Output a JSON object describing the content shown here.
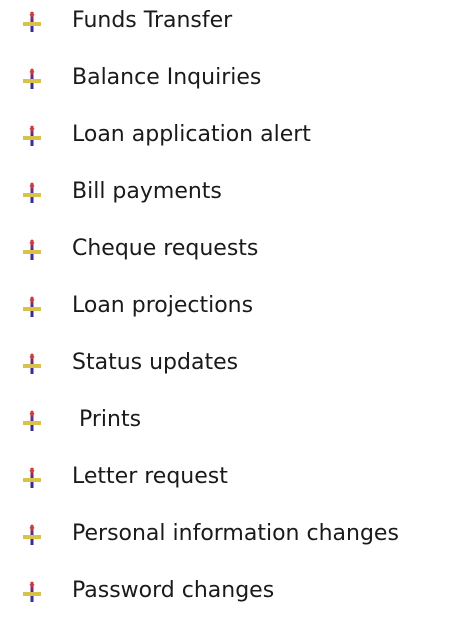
{
  "colors": {
    "bullet_bar": "#d9c24a",
    "bullet_stem": "#3a2a9a",
    "bullet_accent": "#d23a3a",
    "text": "#1a1a1a"
  },
  "bullet_icon": "arrow-cross-bullet-icon",
  "items": [
    {
      "label": "Funds Transfer"
    },
    {
      "label": "Balance Inquiries"
    },
    {
      "label": "Loan application alert"
    },
    {
      "label": "Bill payments"
    },
    {
      "label": "Cheque requests"
    },
    {
      "label": "Loan projections"
    },
    {
      "label": "Status updates"
    },
    {
      "label": " Prints"
    },
    {
      "label": "Letter request"
    },
    {
      "label": "Personal information changes"
    },
    {
      "label": "Password changes"
    }
  ]
}
